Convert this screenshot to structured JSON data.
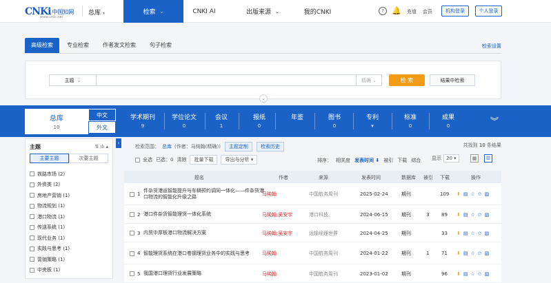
{
  "topbar": {
    "logo_mark": "CNKi",
    "logo_cn": "中国知网",
    "logo_sub": "www.cnki.net",
    "home": "总库",
    "tabs": [
      {
        "label": "检索"
      },
      {
        "label": "CNKI AI"
      },
      {
        "label": "出版来源"
      },
      {
        "label": "我的CNKI"
      }
    ],
    "help": "?",
    "link_chong": "充值",
    "link_vip": "会员",
    "btn_org": "机构登录",
    "btn_user": "个人登录"
  },
  "search_tabs": [
    {
      "label": "高级检索"
    },
    {
      "label": "专业检索"
    },
    {
      "label": "作者发文检索"
    },
    {
      "label": "句子检索"
    }
  ],
  "search_settings": "检索设置",
  "search": {
    "field": "主题",
    "value": "",
    "match": "精确",
    "btn": "检 索",
    "btn2": "结果中检索"
  },
  "db": {
    "all": {
      "label": "总库",
      "count": "10"
    },
    "lang_zh": "中文",
    "lang_en": "外文",
    "items": [
      {
        "label": "学术期刊",
        "count": "9"
      },
      {
        "label": "学位论文",
        "count": "0"
      },
      {
        "label": "会议",
        "count": "1"
      },
      {
        "label": "报纸",
        "count": "0"
      },
      {
        "label": "年鉴",
        "count": ""
      },
      {
        "label": "图书",
        "count": "0"
      },
      {
        "label": "专利",
        "count": "▾"
      },
      {
        "label": "标准",
        "count": "0"
      },
      {
        "label": "成果",
        "count": "0"
      }
    ]
  },
  "sidebar": {
    "title": "主题",
    "tools": "⇅ ılı ▴",
    "tab1": "主要主题",
    "tab2": "次要主题",
    "items": [
      {
        "label": "铁路市场 (2)"
      },
      {
        "label": "外资类 (2)"
      },
      {
        "label": "房地产营销 (1)"
      },
      {
        "label": "物流规划 (1)"
      },
      {
        "label": "港口物流 (1)"
      },
      {
        "label": "传送系统 (1)"
      },
      {
        "label": "现代业务 (1)"
      },
      {
        "label": "实践与思考 (1)"
      },
      {
        "label": "营销策略 (1)"
      },
      {
        "label": "中央板 (1)"
      }
    ]
  },
  "results": {
    "scope_label": "检索范围：",
    "scope_db": "总库",
    "scope_query": "(作者：马纯翰(精确))",
    "chip1": "主题定制",
    "chip2": "检索历史",
    "count_pre": "共找到",
    "count": "10",
    "count_post": "条结果",
    "select_all": "全选",
    "selected": "已选：0",
    "clear": "清除",
    "batch": "批量下载",
    "export": "导出与分析 ▾",
    "sort_label": "排序：",
    "sort": [
      {
        "label": "相关度"
      },
      {
        "label": "发表时间 ⬇"
      },
      {
        "label": "被引"
      },
      {
        "label": "下载"
      },
      {
        "label": "综合"
      }
    ],
    "show_label": "显示",
    "show_value": "20 ▾",
    "columns": {
      "title": "题名",
      "author": "作者",
      "source": "来源",
      "date": "发表时间",
      "db": "数据库",
      "cited": "被引",
      "dl": "下载",
      "ops": "操作"
    },
    "rows": [
      {
        "num": "1",
        "title": "件杂货港运智能提升与车辆预约调同一体化——件杂货港口物流的智能化升级之路",
        "author": "马纯翰",
        "source": "中国航务周刊",
        "date": "2025-02-24",
        "db": "期刊",
        "cited": "",
        "dl": "109"
      },
      {
        "num": "2",
        "title": "港口件杂货智能理货一体化系统",
        "author": "马纯翰;吴安宇",
        "source": "港口科技",
        "date": "2024-06-15",
        "db": "期刊",
        "cited": "3",
        "dl": "89"
      },
      {
        "num": "3",
        "title": "内贸中厚板港口物流解决方案",
        "author": "马纯翰;吴安宇",
        "source": "运输经理世界",
        "date": "2024-04-25",
        "db": "期刊",
        "cited": "",
        "dl": "33"
      },
      {
        "num": "4",
        "title": "智能理货系统在港口卷钢理货业务中的实践与思考",
        "author": "马纯翰",
        "source": "中国航务周刊",
        "date": "2024-01-22",
        "db": "期刊",
        "cited": "1",
        "dl": "71"
      },
      {
        "num": "5",
        "title": "我国港口理货行业发展策略",
        "author": "马纯翰",
        "source": "中国航务周刊",
        "date": "2023-01-02",
        "db": "期刊",
        "cited": "",
        "dl": "96"
      }
    ]
  }
}
